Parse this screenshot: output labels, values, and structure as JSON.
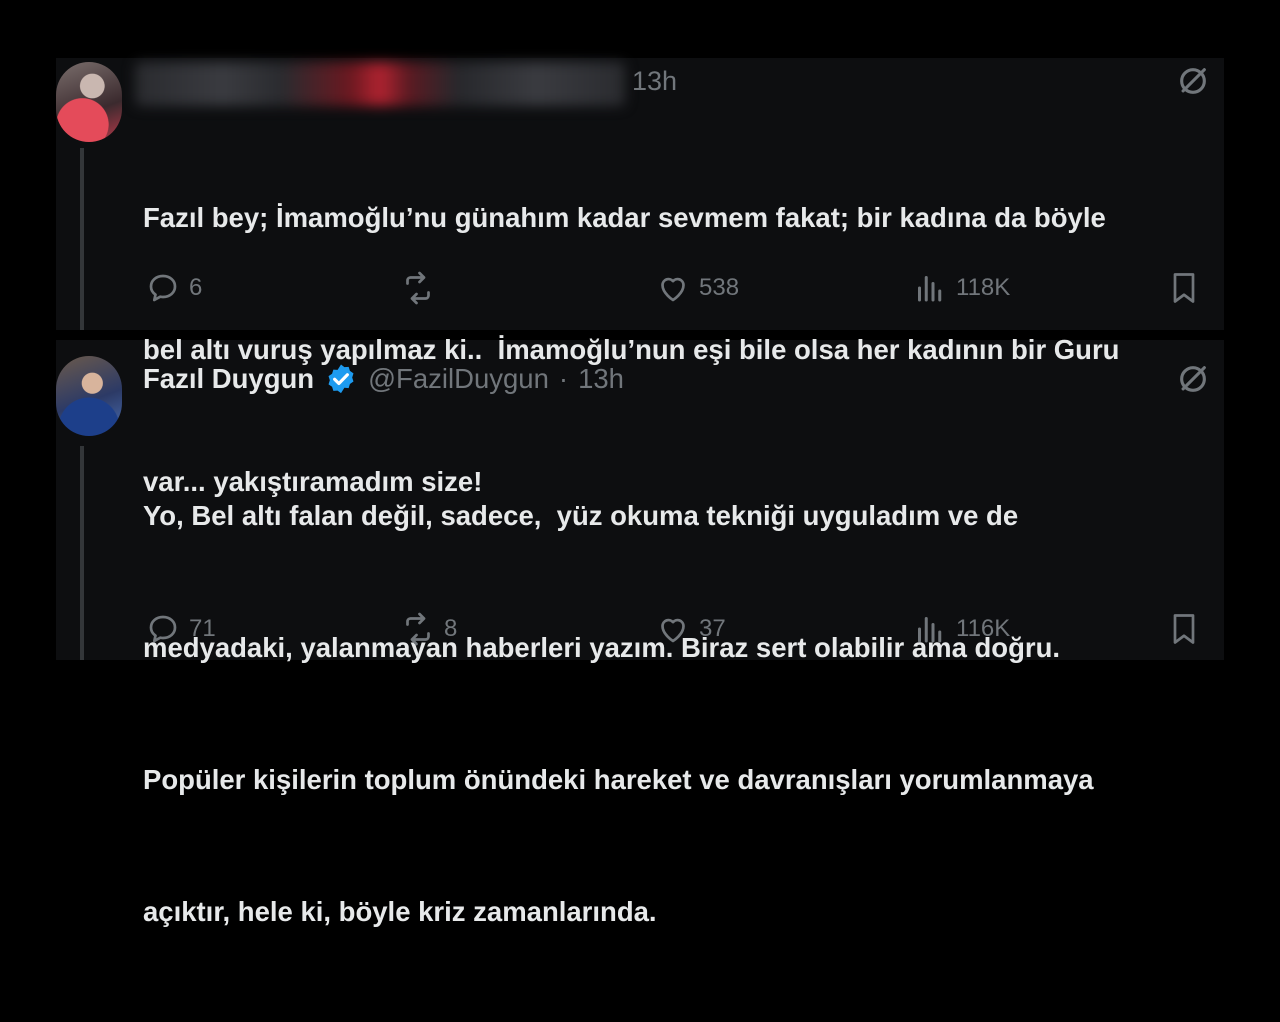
{
  "tweets": [
    {
      "time": "13h",
      "text_lines": [
        "Fazıl bey; İmamoğlu’nu günahım kadar sevmem fakat; bir kadına da böyle",
        "bel altı vuruş yapılmaz ki..  İmamoğlu’nun eşi bile olsa her kadının bir Guru",
        "var... yakıştıramadım size!"
      ],
      "actions": {
        "replies": "6",
        "retweets": "",
        "likes": "538",
        "views": "118K"
      }
    },
    {
      "author_name": "Fazıl Duygun",
      "handle": "@FazilDuygun",
      "separator": "·",
      "time": "13h",
      "text_lines": [
        "Yo, Bel altı falan değil, sadece,  yüz okuma tekniği uyguladım ve de",
        "medyadaki, yalanmayan haberleri yazım. Biraz sert olabilir ama doğru.",
        "Popüler kişilerin toplum önündeki hareket ve davranışları yorumlanmaya",
        "açıktır, hele ki, böyle kriz zamanlarında."
      ],
      "actions": {
        "replies": "71",
        "retweets": "8",
        "likes": "37",
        "views": "116K"
      }
    }
  ],
  "icons": {
    "reply": "reply-icon",
    "retweet": "retweet-icon",
    "like": "heart-icon",
    "views": "views-icon",
    "bookmark": "bookmark-icon",
    "grok": "grok-icon",
    "verified": "verified-badge-icon"
  },
  "colors": {
    "background": "#000000",
    "panel": "#0d0e10",
    "text": "#e7e9ea",
    "muted": "#71767b",
    "verified": "#1d9bf0"
  }
}
